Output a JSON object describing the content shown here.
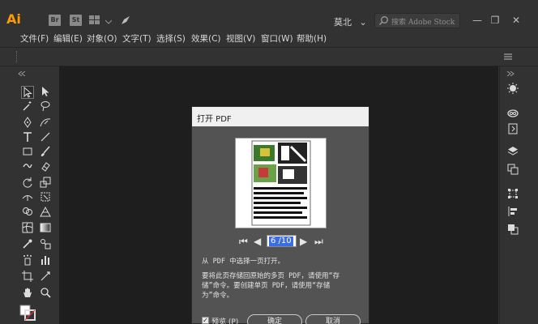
{
  "titlebar": {
    "logo": "Ai",
    "bridge_label": "Br",
    "stock_label": "St",
    "workspace": "莫北",
    "workspace_arrow": "⌄",
    "search_placeholder": "搜索 Adobe Stock",
    "minimize": "—",
    "maximize": "❐",
    "close": "✕"
  },
  "menu": {
    "items": [
      "文件(F)",
      "编辑(E)",
      "对象(O)",
      "文字(T)",
      "选择(S)",
      "效果(C)",
      "视图(V)",
      "窗口(W)",
      "帮助(H)"
    ]
  },
  "dialog": {
    "title": "打开 PDF",
    "page_value": "6 /10",
    "first_page": "⏮",
    "prev_page": "◀",
    "next_page": "▶",
    "last_page": "⏭",
    "instruction": "从 PDF 中选择一页打开。",
    "description_line1": "要将此页存储回原始的多页 PDF，请使用“存",
    "description_line2": "储”命令。要创建单页 PDF，请使用“存储",
    "description_line3": "为”命令。",
    "preview_checkbox_label": "预览 (P)",
    "ok_button": "确定",
    "cancel_button": "取消"
  },
  "colors": {
    "chrome": "#323232",
    "canvas": "#1e1e1e",
    "dialog": "#535353",
    "accent": "#ff9a00",
    "selection": "#3b6ee0"
  }
}
